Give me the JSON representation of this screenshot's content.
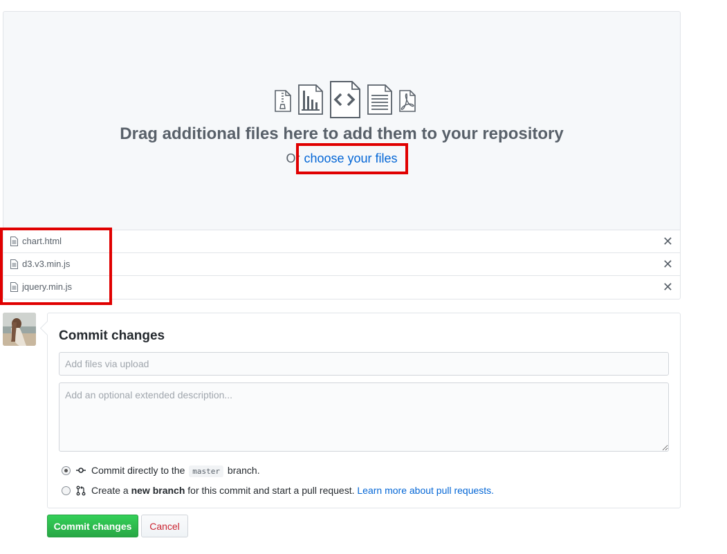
{
  "dropzone": {
    "title": "Drag additional files here to add them to your repository",
    "or_text": "Or",
    "choose_link": "choose your files"
  },
  "files": [
    {
      "name": "chart.html",
      "remove": "✕"
    },
    {
      "name": "d3.v3.min.js",
      "remove": "✕"
    },
    {
      "name": "jquery.min.js",
      "remove": "✕"
    }
  ],
  "commit": {
    "title": "Commit changes",
    "summary_placeholder": "Add files via upload",
    "description_placeholder": "Add an optional extended description...",
    "option_direct": {
      "text_before": "Commit directly to the",
      "branch": "master",
      "text_after": "branch.",
      "checked": true
    },
    "option_new_branch": {
      "text_before": "Create a",
      "bold": "new branch",
      "text_after": "for this commit and start a pull request.",
      "link": "Learn more about pull requests.",
      "checked": false
    }
  },
  "buttons": {
    "commit": "Commit changes",
    "cancel": "Cancel"
  },
  "colors": {
    "annotation": "#e00000",
    "link": "#0366d6",
    "commit_button": "#28a745",
    "cancel_text": "#cb2431"
  }
}
